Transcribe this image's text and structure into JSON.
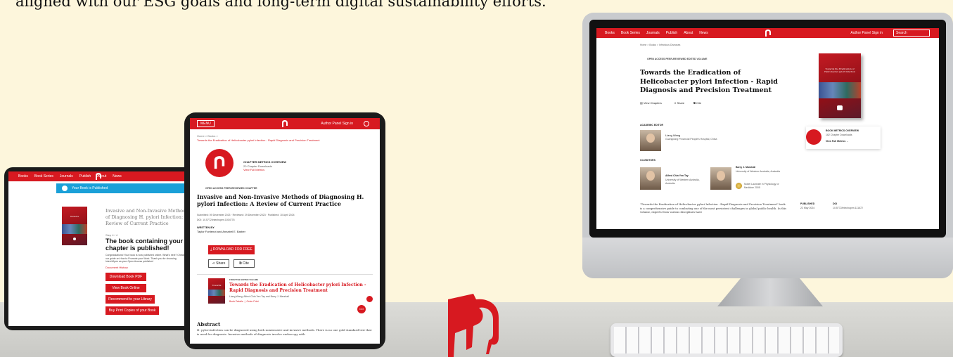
{
  "headline": "aligned with our ESG goals and long-term digital sustainability efforts.",
  "desktop": {
    "nav": [
      "Books",
      "Book Series",
      "Journals",
      "Publish",
      "About",
      "News"
    ],
    "nav_right": "Author Panel Sign in",
    "search_placeholder": "Search",
    "breadcrumb": "Home > Books > Infectious Diseases",
    "badge": "OPEN ACCESS PEER-REVIEWED EDITED VOLUME",
    "title": "Towards the Eradication of Helicobacter pylori Infection - Rapid Diagnosis and Precision Treatment",
    "actions": [
      "View Chapters",
      "Share",
      "Cite"
    ],
    "metrics_heading": "BOOK METRICS OVERVIEW",
    "metrics_downloads": "162 Chapter Downloads",
    "metrics_link": "View Full Metrics",
    "academic_editor_label": "ACADEMIC EDITOR",
    "editor_name": "Liang Wang",
    "editor_affil": "Guangdong Provincial People's Hospital, China",
    "coeditors_label": "CO-EDITORS",
    "coeditor1_name": "Alfred Chin Yen Tay",
    "coeditor1_affil": "University of Western Australia, Australia",
    "coeditor2_name": "Barry J. Marshall",
    "coeditor2_affil": "University of Western Australia, Australia",
    "nobel": "Nobel Laureate in Physiology or Medicine 2005",
    "abstract": "\"Towards the Eradication of Helicobacter pylori Infection - Rapid Diagnosis and Precision Treatment\" book is a comprehensive guide to combating one of the most persistent challenges in global public health. In this volume, experts from various disciplines have",
    "published_label": "PUBLISHED",
    "published_value": "22 May 2024",
    "doi_label": "DOI",
    "doi_value": "10.5772/intechopen.111672"
  },
  "tablet_left": {
    "nav": [
      "Books",
      "Book Series",
      "Journals",
      "Publish",
      "About",
      "News"
    ],
    "banner": "Your Book is Published",
    "book_title": "Invasive and Non-Invasive Methods of Diagnosing H. pylori Infection: A Review of Current Practice",
    "step": "Step 4 / 4",
    "heading": "The book containing your chapter is published!",
    "body": "Congratulations! Your book is now published online. What's next? Check out our guide on How to Promote your Work. Thank you for choosing IntechOpen as your Open Access publisher!",
    "history_link": "Document History",
    "buttons": [
      "Download Book PDF",
      "View Book Online",
      "Recommend to your Library",
      "Buy Print Copies of your Book"
    ]
  },
  "tablet_mid": {
    "menu": "MENU",
    "nav_right": "Author Panel Sign in",
    "breadcrumb": "Home > Books >",
    "breadcrumb_link": "Towards the Eradication of Helicobacter pylori Infection - Rapid Diagnosis and Precision Treatment",
    "metrics_heading": "CHAPTER METRICS OVERVIEW",
    "metrics_downloads": "20 Chapter Downloads",
    "metrics_link": "View Full Metrics",
    "badge": "OPEN ACCESS PEER-REVIEWED CHAPTER",
    "title": "Invasive and Non-Invasive Methods of Diagnosing H. pylori Infection: A Review of Current Practice",
    "dates": "Submitted: 09 December 2023 · Reviewed: 29 December 2023 · Published: 10 April 2024",
    "doi": "DOI: 10.5772/intechopen.1004776",
    "written_by": "WRITTEN BY",
    "authors": "Taylor Fontenot and Annabel E. Barber",
    "download": "DOWNLOAD FOR FREE",
    "share": "Share",
    "cite": "Cite",
    "from_label": "FROM THE EDITED VOLUME",
    "volume_title": "Towards the Eradication of Helicobacter pylori Infection - Rapid Diagnosis and Precision Treatment",
    "volume_editors": "Liang Wang, Alfred Chin Yen Tay and Barry J. Marshall",
    "volume_links": "Book Details  |  Order Print",
    "abstract_heading": "Abstract",
    "abstract": "H. pylori infection can be diagnosed using both noninvasive and invasive methods. There is no one gold standard test that is used for diagnosis. Invasive methods of diagnosis involve endoscopy with",
    "fab": "CO"
  },
  "colors": {
    "brand": "#d71920",
    "background": "#fdf6dc"
  },
  "icons": [
    "intechopen-logo-icon",
    "share-icon",
    "cite-icon",
    "download-icon",
    "search-icon",
    "chapters-icon",
    "arrow-right-icon",
    "check-icon"
  ]
}
